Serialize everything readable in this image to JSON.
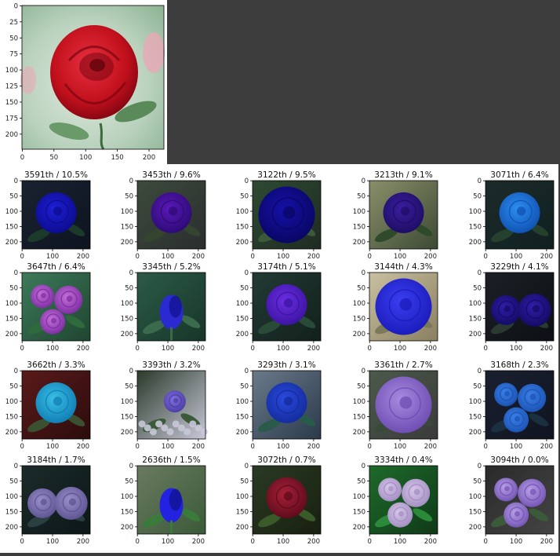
{
  "query": {
    "x_ticks": [
      "0",
      "50",
      "100",
      "150",
      "200"
    ],
    "y_ticks": [
      "0",
      "25",
      "50",
      "75",
      "100",
      "125",
      "150",
      "175",
      "200"
    ],
    "image_icon": "red-rose-image",
    "colors": {
      "petal": "#c0101c",
      "petal_dark": "#7a0410",
      "bg_light": "#dfe8de",
      "bg_green": "#8fb595",
      "bg_pink": "#e9a8b6"
    }
  },
  "results": {
    "x_ticks": [
      "0",
      "100",
      "200"
    ],
    "y_ticks": [
      "0",
      "50",
      "100",
      "150",
      "200"
    ],
    "items": [
      {
        "title": "3591th /  10.5%",
        "bg": "#1a2230",
        "bg2": "#0d1420",
        "flower": "#1d1fd6",
        "flower2": "#0b0b8a",
        "leaf": "#1b3a2b",
        "layout": "single"
      },
      {
        "title": "3453th /  9.6%",
        "bg": "#3d4a3c",
        "bg2": "#2a2e2e",
        "flower": "#5a18b8",
        "flower2": "#2a0a70",
        "leaf": "#33442f",
        "layout": "single"
      },
      {
        "title": "3122th /  9.5%",
        "bg": "#2e4a32",
        "bg2": "#1f2b22",
        "flower": "#1610a8",
        "flower2": "#080660",
        "leaf": "#3b5a3a",
        "layout": "big"
      },
      {
        "title": "3213th /  9.1%",
        "bg": "#8a8f6a",
        "bg2": "#3c4a34",
        "flower": "#3b1da0",
        "flower2": "#1c0d60",
        "leaf": "#2f4a2a",
        "layout": "single"
      },
      {
        "title": "3071th /  6.4%",
        "bg": "#1d2a2a",
        "bg2": "#102020",
        "flower": "#2e8ef0",
        "flower2": "#0d4fb0",
        "leaf": "#25402c",
        "layout": "single"
      },
      {
        "title": "3647th /  6.4%",
        "bg": "#3d7a5a",
        "bg2": "#1f4530",
        "flower": "#c470d8",
        "flower2": "#7a2aa0",
        "leaf": "#2f6a3c",
        "layout": "multi"
      },
      {
        "title": "3345th /  5.2%",
        "bg": "#2c5a48",
        "bg2": "#173628",
        "flower": "#2a2ad0",
        "flower2": "#10108a",
        "leaf": "#3b6a4c",
        "layout": "bud"
      },
      {
        "title": "3174th /  5.1%",
        "bg": "#233a34",
        "bg2": "#12201c",
        "flower": "#6a2ee0",
        "flower2": "#3a12a0",
        "leaf": "#2a4a38",
        "layout": "single"
      },
      {
        "title": "3144th /  4.3%",
        "bg": "#c8c0a0",
        "bg2": "#8a7f60",
        "flower": "#3a3ef0",
        "flower2": "#1a1ab8",
        "leaf": "#7a7a58",
        "layout": "big"
      },
      {
        "title": "3229th /  4.1%",
        "bg": "#1c2026",
        "bg2": "#0c1014",
        "flower": "#2e1ea8",
        "flower2": "#120a60",
        "leaf": "#2a3a30",
        "layout": "pair"
      },
      {
        "title": "3662th /  3.3%",
        "bg": "#5a1a1a",
        "bg2": "#2c0c0c",
        "flower": "#38c0e8",
        "flower2": "#0f7ab0",
        "leaf": "#3a5030",
        "layout": "single"
      },
      {
        "title": "3393th /  3.2%",
        "bg": "#2a3a2a",
        "bg2": "#c8c8d8",
        "flower": "#8070e0",
        "flower2": "#4a3aa0",
        "leaf": "#3a5a3a",
        "layout": "field"
      },
      {
        "title": "3293th /  3.1%",
        "bg": "#6a7a8a",
        "bg2": "#2a3a4a",
        "flower": "#2a4ae0",
        "flower2": "#122a98",
        "leaf": "#2a5a4a",
        "layout": "single"
      },
      {
        "title": "3361th /  2.7%",
        "bg": "#4a5a4a",
        "bg2": "#3a3a3a",
        "flower": "#a88ae0",
        "flower2": "#6a4ab0",
        "leaf": "#3a4a3a",
        "layout": "big"
      },
      {
        "title": "3168th /  2.3%",
        "bg": "#1a2030",
        "bg2": "#101420",
        "flower": "#3a80e8",
        "flower2": "#1a50b0",
        "leaf": "#1a3040",
        "layout": "multi"
      },
      {
        "title": "3184th /  1.7%",
        "bg": "#1c2a2a",
        "bg2": "#0c1818",
        "flower": "#9a90c8",
        "flower2": "#5a5090",
        "leaf": "#2a4040",
        "layout": "pair"
      },
      {
        "title": "2636th /  1.5%",
        "bg": "#6a7a60",
        "bg2": "#3a5a38",
        "flower": "#2222e0",
        "flower2": "#10108a",
        "leaf": "#3a7a3a",
        "layout": "bud"
      },
      {
        "title": "3072th /  0.7%",
        "bg": "#2a3a24",
        "bg2": "#18200f",
        "flower": "#a82038",
        "flower2": "#5a0a1a",
        "leaf": "#3a5a2a",
        "layout": "single"
      },
      {
        "title": "3334th /  0.4%",
        "bg": "#1e6a2a",
        "bg2": "#0f3a18",
        "flower": "#d8c8e8",
        "flower2": "#a08ac0",
        "leaf": "#2a8a3a",
        "layout": "multi"
      },
      {
        "title": "3094th /  0.0%",
        "bg": "#2a2a2a",
        "bg2": "#444444",
        "flower": "#b8a0e8",
        "flower2": "#7050b0",
        "leaf": "#3a5a3a",
        "layout": "multi"
      }
    ]
  }
}
